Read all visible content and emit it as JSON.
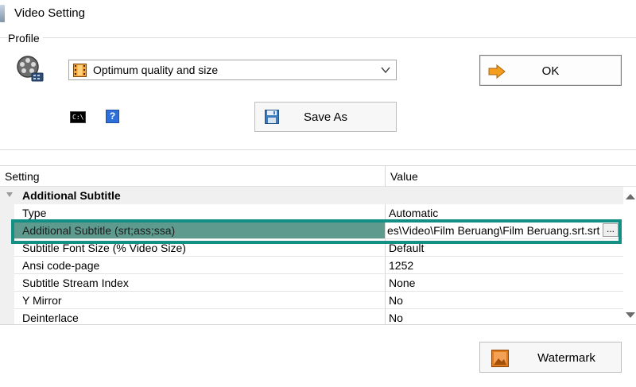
{
  "window": {
    "title": "Video Setting",
    "icon": "app-icon"
  },
  "profile": {
    "group_label": "Profile",
    "selected_value": "Optimum quality and size",
    "ok_label": "OK",
    "save_as_label": "Save As",
    "cmd_icon_text": "C:\\",
    "help_icon_text": "?"
  },
  "grid": {
    "col_setting": "Setting",
    "col_value": "Value",
    "category": "Additional Subtitle",
    "rows": [
      {
        "name": "Type",
        "value": "Automatic"
      },
      {
        "name": "Additional Subtitle (srt;ass;ssa)",
        "value": "es\\Video\\Film Beruang\\Film Beruang.srt.srt",
        "selected": true
      },
      {
        "name": "Subtitle Font Size (% Video Size)",
        "value": "Default"
      },
      {
        "name": "Ansi code-page",
        "value": "1252"
      },
      {
        "name": "Subtitle Stream Index",
        "value": "None"
      },
      {
        "name": "Y Mirror",
        "value": "No"
      },
      {
        "name": "Deinterlace",
        "value": "No"
      }
    ],
    "browse_label": "..."
  },
  "watermark_label": "Watermark",
  "colors": {
    "selection": "#5f9a8f",
    "highlight_frame": "#138f86",
    "ok_arrow": "#f39c1e"
  }
}
